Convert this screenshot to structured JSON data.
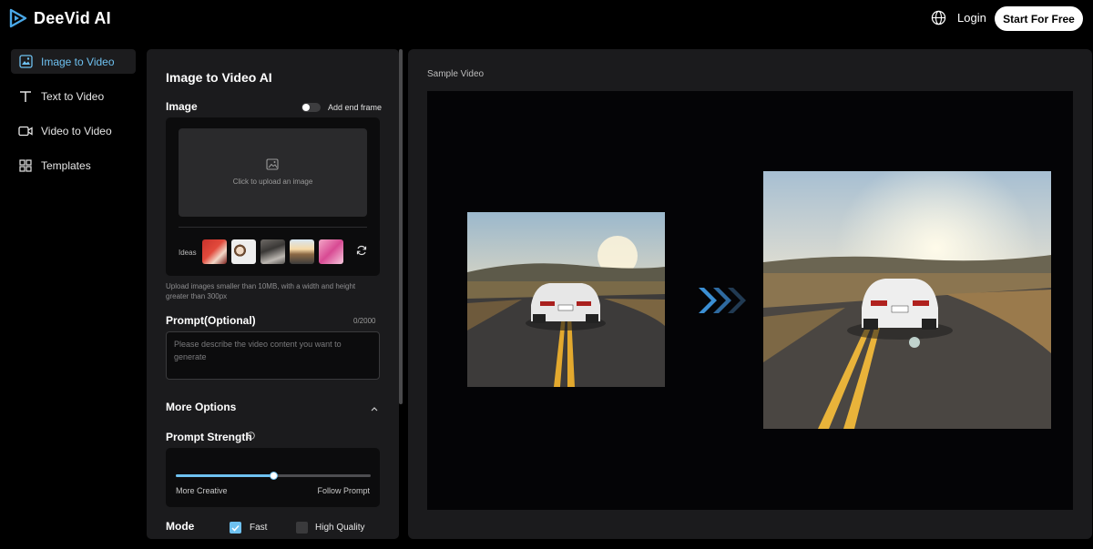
{
  "brand": {
    "name": "DeeVid AI"
  },
  "header": {
    "login": "Login",
    "cta": "Start For Free"
  },
  "sidebar": {
    "items": [
      {
        "label": "Image to Video",
        "icon": "image-video-icon",
        "active": true
      },
      {
        "label": "Text to Video",
        "icon": "text-icon",
        "active": false
      },
      {
        "label": "Video to Video",
        "icon": "video-camera-icon",
        "active": false
      },
      {
        "label": "Templates",
        "icon": "grid-icon",
        "active": false
      }
    ]
  },
  "form": {
    "title": "Image to Video AI",
    "image_label": "Image",
    "end_frame_toggle": {
      "label": "Add end frame",
      "on": false
    },
    "upload_text": "Click to upload an image",
    "ideas_label": "Ideas",
    "upload_hint": "Upload images smaller than 10MB, with a width and height greater than 300px",
    "prompt_label": "Prompt(Optional)",
    "prompt_count": "0/2000",
    "prompt_placeholder": "Please describe the video content you want to generate",
    "more_options": "More Options",
    "strength_label": "Prompt Strength",
    "strength_value": 0.5,
    "strength_min_label": "More Creative",
    "strength_max_label": "Follow Prompt",
    "mode_label": "Mode",
    "modes": [
      {
        "label": "Fast",
        "checked": true
      },
      {
        "label": "High Quality",
        "checked": false
      }
    ]
  },
  "preview": {
    "label": "Sample Video"
  },
  "colors": {
    "accent": "#6ec1f0",
    "panel": "#1b1b1d",
    "background": "#000000"
  }
}
